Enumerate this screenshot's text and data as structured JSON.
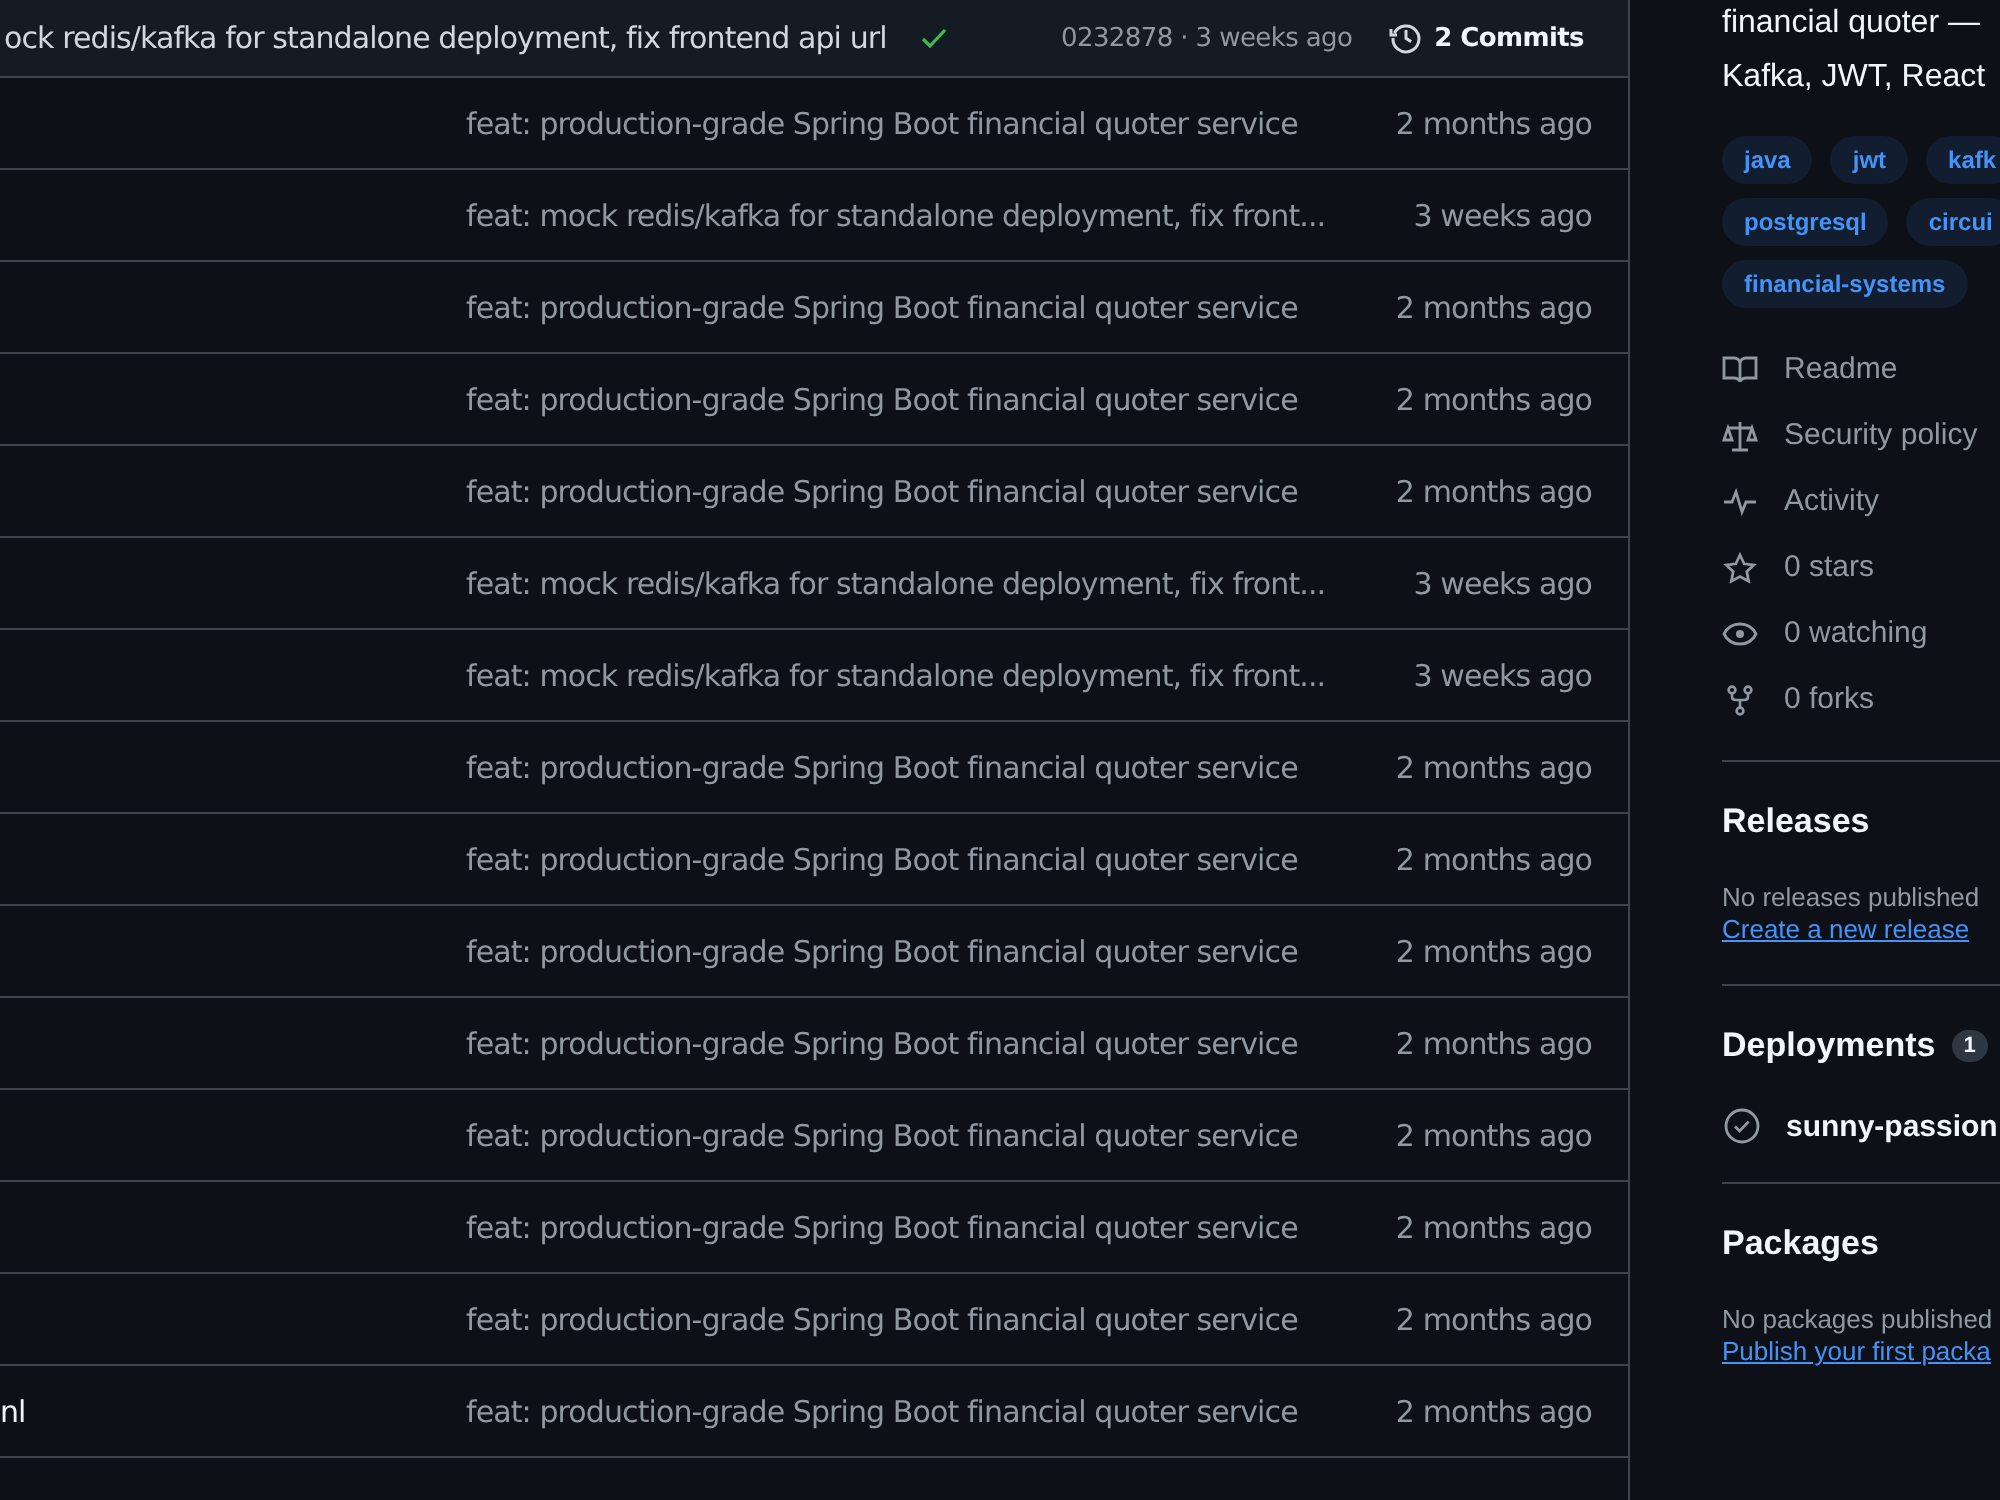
{
  "latest_commit": {
    "message": "ock redis/kafka for standalone deployment, fix frontend api url",
    "checks_passed": true,
    "hash_time": "0232878 · 3 weeks ago",
    "commits": "2 Commits"
  },
  "files": [
    {
      "message": "feat: production-grade Spring Boot financial quoter service",
      "time": "2 months ago"
    },
    {
      "message": "feat: mock redis/kafka for standalone deployment, fix front...",
      "time": "3 weeks ago"
    },
    {
      "message": "feat: production-grade Spring Boot financial quoter service",
      "time": "2 months ago"
    },
    {
      "message": "feat: production-grade Spring Boot financial quoter service",
      "time": "2 months ago"
    },
    {
      "message": "feat: production-grade Spring Boot financial quoter service",
      "time": "2 months ago"
    },
    {
      "message": "feat: mock redis/kafka for standalone deployment, fix front...",
      "time": "3 weeks ago"
    },
    {
      "message": "feat: mock redis/kafka for standalone deployment, fix front...",
      "time": "3 weeks ago"
    },
    {
      "message": "feat: production-grade Spring Boot financial quoter service",
      "time": "2 months ago"
    },
    {
      "message": "feat: production-grade Spring Boot financial quoter service",
      "time": "2 months ago"
    },
    {
      "message": "feat: production-grade Spring Boot financial quoter service",
      "time": "2 months ago"
    },
    {
      "message": "feat: production-grade Spring Boot financial quoter service",
      "time": "2 months ago"
    },
    {
      "message": "feat: production-grade Spring Boot financial quoter service",
      "time": "2 months ago"
    },
    {
      "message": "feat: production-grade Spring Boot financial quoter service",
      "time": "2 months ago"
    },
    {
      "message": "feat: production-grade Spring Boot financial quoter service",
      "time": "2 months ago"
    },
    {
      "name": "nl",
      "message": "feat: production-grade Spring Boot financial quoter service",
      "time": "2 months ago"
    }
  ],
  "about": {
    "description": [
      "financial quoter —",
      "Kafka, JWT, React"
    ],
    "topics": [
      [
        "java",
        "jwt",
        "kafk"
      ],
      [
        "postgresql",
        "circui"
      ],
      [
        "financial-systems"
      ]
    ],
    "links": [
      {
        "kind": "book",
        "label": "Readme"
      },
      {
        "kind": "scale",
        "label": "Security policy"
      },
      {
        "kind": "pulse",
        "label": "Activity"
      },
      {
        "kind": "star",
        "label": "0 stars"
      },
      {
        "kind": "eye",
        "label": "0 watching"
      },
      {
        "kind": "fork",
        "label": "0 forks"
      }
    ]
  },
  "releases": {
    "title": "Releases",
    "note": "No releases published",
    "link": "Create a new release"
  },
  "deployments": {
    "title": "Deployments",
    "count": "1",
    "items": [
      "sunny-passion"
    ]
  },
  "packages": {
    "title": "Packages",
    "note": "No packages published",
    "link": "Publish your first packa"
  }
}
